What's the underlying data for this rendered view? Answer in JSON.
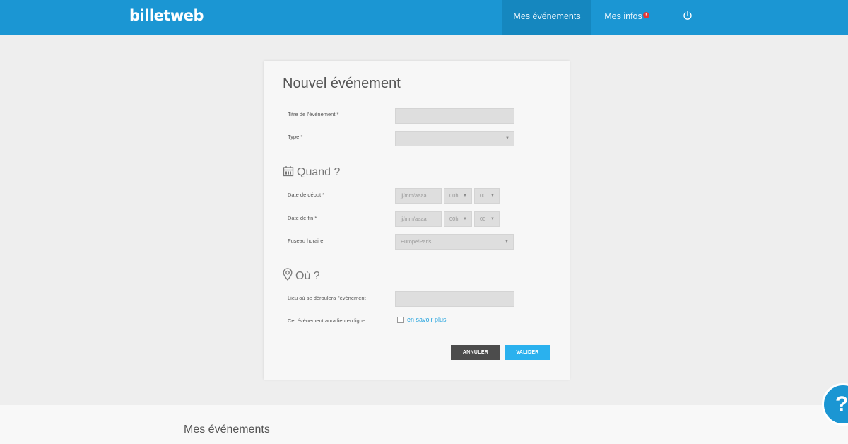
{
  "app": {
    "logo": "billetweb"
  },
  "nav": {
    "events": "Mes événements",
    "infos": "Mes infos",
    "infos_badge": "!",
    "power_icon": "power-icon"
  },
  "form": {
    "title": "Nouvel événement",
    "fields": {
      "title_label": "Titre de l'événement *",
      "title_value": "",
      "type_label": "Type *",
      "type_value": ""
    },
    "when": {
      "section_title": "Quand ?",
      "icon": "calendar-icon",
      "start_label": "Date de début *",
      "start_date_placeholder": "jj/mm/aaaa",
      "start_hour": "00h",
      "start_min": "00",
      "end_label": "Date de fin *",
      "end_date_placeholder": "jj/mm/aaaa",
      "end_hour": "00h",
      "end_min": "00",
      "tz_label": "Fuseau horaire",
      "tz_value": "Europe/Paris"
    },
    "where": {
      "section_title": "Où ?",
      "icon": "map-pin-icon",
      "place_label": "Lieu où se déroulera l'événement",
      "place_value": "",
      "online_label": "Cet événement aura lieu en ligne",
      "online_link": "en savoir plus"
    },
    "buttons": {
      "cancel": "ANNULER",
      "validate": "VALIDER"
    }
  },
  "bottom": {
    "title": "Mes événements"
  },
  "help": {
    "label": "?"
  },
  "colors": {
    "primary": "#1b96d3",
    "accent": "#2ab1ee",
    "dark_button": "#4c4c4c",
    "badge": "#e53935"
  }
}
